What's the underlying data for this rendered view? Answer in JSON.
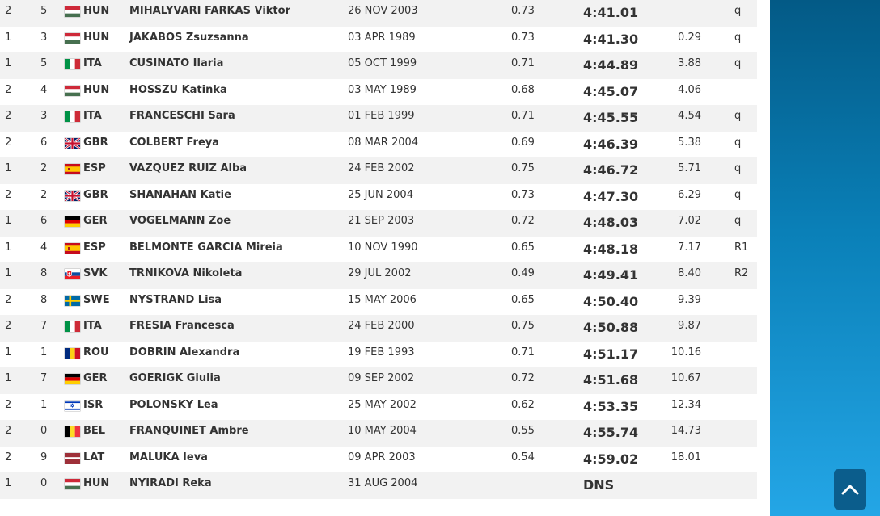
{
  "results": [
    {
      "heat": "2",
      "lane": "5",
      "nat": "HUN",
      "flag": "hun",
      "name": "MIHALYVARI FARKAS Viktor",
      "dob": "26 NOV 2003",
      "rt": "0.73",
      "time": "4:41.01",
      "behind": "",
      "q": "q"
    },
    {
      "heat": "1",
      "lane": "3",
      "nat": "HUN",
      "flag": "hun",
      "name": "JAKABOS Zsuzsanna",
      "dob": "03 APR 1989",
      "rt": "0.73",
      "time": "4:41.30",
      "behind": "0.29",
      "q": "q"
    },
    {
      "heat": "1",
      "lane": "5",
      "nat": "ITA",
      "flag": "ita",
      "name": "CUSINATO Ilaria",
      "dob": "05 OCT 1999",
      "rt": "0.71",
      "time": "4:44.89",
      "behind": "3.88",
      "q": "q"
    },
    {
      "heat": "2",
      "lane": "4",
      "nat": "HUN",
      "flag": "hun",
      "name": "HOSSZU Katinka",
      "dob": "03 MAY 1989",
      "rt": "0.68",
      "time": "4:45.07",
      "behind": "4.06",
      "q": ""
    },
    {
      "heat": "2",
      "lane": "3",
      "nat": "ITA",
      "flag": "ita",
      "name": "FRANCESCHI Sara",
      "dob": "01 FEB 1999",
      "rt": "0.71",
      "time": "4:45.55",
      "behind": "4.54",
      "q": "q"
    },
    {
      "heat": "2",
      "lane": "6",
      "nat": "GBR",
      "flag": "gbr",
      "name": "COLBERT Freya",
      "dob": "08 MAR 2004",
      "rt": "0.69",
      "time": "4:46.39",
      "behind": "5.38",
      "q": "q"
    },
    {
      "heat": "1",
      "lane": "2",
      "nat": "ESP",
      "flag": "esp",
      "name": "VAZQUEZ RUIZ Alba",
      "dob": "24 FEB 2002",
      "rt": "0.75",
      "time": "4:46.72",
      "behind": "5.71",
      "q": "q"
    },
    {
      "heat": "2",
      "lane": "2",
      "nat": "GBR",
      "flag": "gbr",
      "name": "SHANAHAN Katie",
      "dob": "25 JUN 2004",
      "rt": "0.73",
      "time": "4:47.30",
      "behind": "6.29",
      "q": "q"
    },
    {
      "heat": "1",
      "lane": "6",
      "nat": "GER",
      "flag": "ger",
      "name": "VOGELMANN Zoe",
      "dob": "21 SEP 2003",
      "rt": "0.72",
      "time": "4:48.03",
      "behind": "7.02",
      "q": "q"
    },
    {
      "heat": "1",
      "lane": "4",
      "nat": "ESP",
      "flag": "esp",
      "name": "BELMONTE GARCIA Mireia",
      "dob": "10 NOV 1990",
      "rt": "0.65",
      "time": "4:48.18",
      "behind": "7.17",
      "q": "R1"
    },
    {
      "heat": "1",
      "lane": "8",
      "nat": "SVK",
      "flag": "svk",
      "name": "TRNIKOVA Nikoleta",
      "dob": "29 JUL 2002",
      "rt": "0.49",
      "time": "4:49.41",
      "behind": "8.40",
      "q": "R2"
    },
    {
      "heat": "2",
      "lane": "8",
      "nat": "SWE",
      "flag": "swe",
      "name": "NYSTRAND Lisa",
      "dob": "15 MAY 2006",
      "rt": "0.65",
      "time": "4:50.40",
      "behind": "9.39",
      "q": ""
    },
    {
      "heat": "2",
      "lane": "7",
      "nat": "ITA",
      "flag": "ita",
      "name": "FRESIA Francesca",
      "dob": "24 FEB 2000",
      "rt": "0.75",
      "time": "4:50.88",
      "behind": "9.87",
      "q": ""
    },
    {
      "heat": "1",
      "lane": "1",
      "nat": "ROU",
      "flag": "rou",
      "name": "DOBRIN Alexandra",
      "dob": "19 FEB 1993",
      "rt": "0.71",
      "time": "4:51.17",
      "behind": "10.16",
      "q": ""
    },
    {
      "heat": "1",
      "lane": "7",
      "nat": "GER",
      "flag": "ger",
      "name": "GOERIGK Giulia",
      "dob": "09 SEP 2002",
      "rt": "0.72",
      "time": "4:51.68",
      "behind": "10.67",
      "q": ""
    },
    {
      "heat": "2",
      "lane": "1",
      "nat": "ISR",
      "flag": "isr",
      "name": "POLONSKY Lea",
      "dob": "25 MAY 2002",
      "rt": "0.62",
      "time": "4:53.35",
      "behind": "12.34",
      "q": ""
    },
    {
      "heat": "2",
      "lane": "0",
      "nat": "BEL",
      "flag": "bel",
      "name": "FRANQUINET Ambre",
      "dob": "10 MAY 2004",
      "rt": "0.55",
      "time": "4:55.74",
      "behind": "14.73",
      "q": ""
    },
    {
      "heat": "2",
      "lane": "9",
      "nat": "LAT",
      "flag": "lat",
      "name": "MALUKA Ieva",
      "dob": "09 APR 2003",
      "rt": "0.54",
      "time": "4:59.02",
      "behind": "18.01",
      "q": ""
    },
    {
      "heat": "1",
      "lane": "0",
      "nat": "HUN",
      "flag": "hun",
      "name": "NYIRADI Reka",
      "dob": "31 AUG 2004",
      "rt": "",
      "time": "DNS",
      "behind": "",
      "q": ""
    }
  ],
  "scroll_top": {
    "icon": "chevron-up-icon"
  },
  "colors": {
    "row_alt": "#f2f2f2",
    "side_panel_top": "#035a86",
    "side_panel_bottom": "#24a6e6",
    "button": "#0b5d8c"
  }
}
